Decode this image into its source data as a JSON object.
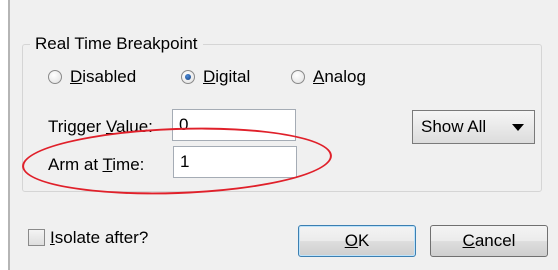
{
  "group": {
    "title": "Real Time Breakpoint"
  },
  "radios": [
    {
      "label_ul": "D",
      "label_rest": "isabled",
      "checked": false
    },
    {
      "label_ul": "D",
      "label_rest": "igital",
      "checked": true
    },
    {
      "label_ul": "A",
      "label_rest": "nalog",
      "checked": false
    }
  ],
  "trigger": {
    "label_pre": "Trigger ",
    "label_ul": "V",
    "label_post": "alue:",
    "value": "0"
  },
  "arm": {
    "label_pre": "Arm at ",
    "label_ul": "T",
    "label_post": "ime:",
    "value": "1"
  },
  "show_all": {
    "value": "Show All",
    "icon": "dropdown-arrow"
  },
  "isolate": {
    "label_ul": "I",
    "label_rest": "solate after?",
    "checked": false
  },
  "buttons": {
    "ok_ul": "O",
    "ok_rest": "K",
    "cancel_ul": "C",
    "cancel_rest": "ancel"
  },
  "colors": {
    "highlight": "#e0202a",
    "dialog_bg": "#f0f0f0"
  }
}
